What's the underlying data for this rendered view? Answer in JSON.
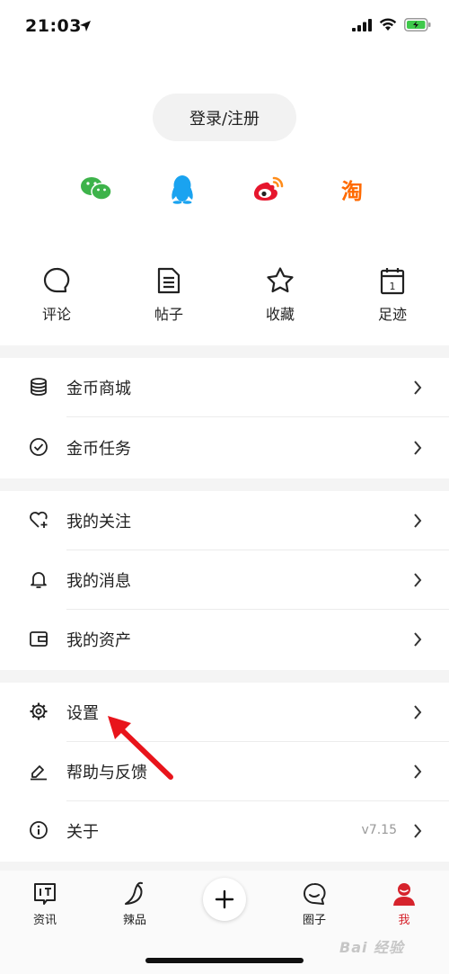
{
  "status_bar": {
    "time": "21:03"
  },
  "account": {
    "login_label": "登录/注册"
  },
  "social_logins": [
    {
      "icon": "wechat-icon",
      "color": "#3db34a"
    },
    {
      "icon": "qq-icon",
      "color": "#1aa3f0"
    },
    {
      "icon": "weibo-icon",
      "color": "#e6162d"
    },
    {
      "icon": "taobao-icon",
      "color": "#ff6a00",
      "glyph": "淘"
    }
  ],
  "quick_actions": [
    {
      "label": "评论",
      "icon": "comment-icon"
    },
    {
      "label": "帖子",
      "icon": "document-icon"
    },
    {
      "label": "收藏",
      "icon": "star-icon"
    },
    {
      "label": "足迹",
      "icon": "calendar-icon",
      "day": "1"
    }
  ],
  "menu_groups": [
    {
      "items": [
        {
          "label": "金币商城",
          "icon": "coins-icon"
        },
        {
          "label": "金币任务",
          "icon": "check-circle-icon"
        }
      ]
    },
    {
      "items": [
        {
          "label": "我的关注",
          "icon": "heart-plus-icon"
        },
        {
          "label": "我的消息",
          "icon": "bell-icon"
        },
        {
          "label": "我的资产",
          "icon": "wallet-icon"
        }
      ]
    },
    {
      "items": [
        {
          "label": "设置",
          "icon": "gear-icon"
        },
        {
          "label": "帮助与反馈",
          "icon": "edit-icon"
        },
        {
          "label": "关于",
          "icon": "info-icon",
          "value": "v7.15"
        }
      ]
    }
  ],
  "tab_bar": [
    {
      "label": "资讯",
      "icon": "news-icon"
    },
    {
      "label": "辣品",
      "icon": "chili-icon"
    },
    {
      "label": "",
      "icon": "plus-icon"
    },
    {
      "label": "圈子",
      "icon": "circle-chat-icon"
    },
    {
      "label": "我",
      "icon": "user-icon",
      "active": true
    }
  ],
  "colors": {
    "accent": "#d6232c",
    "separator": "#f4f4f4",
    "annotation_arrow": "#e8141b"
  },
  "watermark": "Bai 经验"
}
